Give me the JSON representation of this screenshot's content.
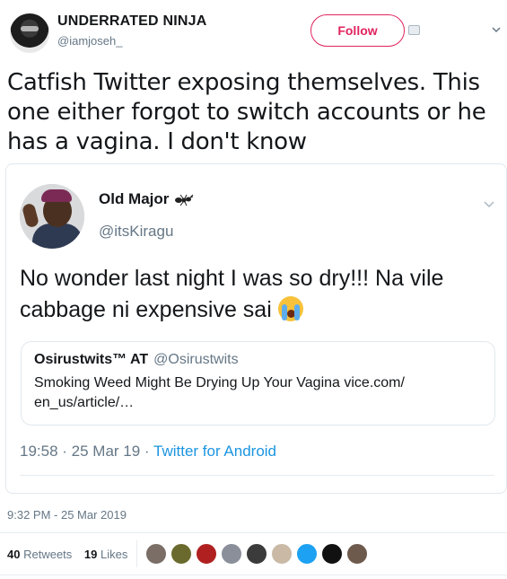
{
  "tweet": {
    "author_name": "UNDERRATED NINJA",
    "author_handle": "@iamjoseh_",
    "follow_label": "Follow",
    "text": "Catfish Twitter exposing themselves. This one either forgot to switch accounts or he has a vagina. I don't know",
    "timestamp": "9:32 PM - 25 Mar 2019",
    "retweets_count": "40",
    "retweets_label": "Retweets",
    "likes_count": "19",
    "likes_label": "Likes"
  },
  "quoted": {
    "author_name": "Old Major",
    "author_handle": "@itsKiragu",
    "text": "No wonder last night I was so dry!!! Na vile cabbage ni expensive sai",
    "emoji_icon": "crying-face-icon",
    "time": "19:58 · 25 Mar 19 ·",
    "source": "Twitter for Android",
    "nested": {
      "author_name": "Osirustwits™ AT",
      "author_handle": "@Osirustwits",
      "text": "Smoking Weed Might Be Drying Up Your Vagina vice.com/ en_us/article/…"
    }
  },
  "likers": [
    {
      "icon": "liker-avatar-1",
      "color": "#7a6e66"
    },
    {
      "icon": "liker-avatar-2",
      "color": "#6b6a2e"
    },
    {
      "icon": "liker-avatar-3",
      "color": "#b02020"
    },
    {
      "icon": "liker-avatar-4",
      "color": "#8a8f9a"
    },
    {
      "icon": "liker-avatar-5",
      "color": "#3b3b3b"
    },
    {
      "icon": "liker-avatar-6",
      "color": "#c9b9a5"
    },
    {
      "icon": "liker-avatar-7",
      "color": "#1da1f2"
    },
    {
      "icon": "liker-avatar-8",
      "color": "#111111"
    },
    {
      "icon": "liker-avatar-9",
      "color": "#6e5a4c"
    }
  ],
  "colors": {
    "accent_follow": "#e0245e",
    "link": "#1b95e0",
    "muted": "#657786"
  }
}
